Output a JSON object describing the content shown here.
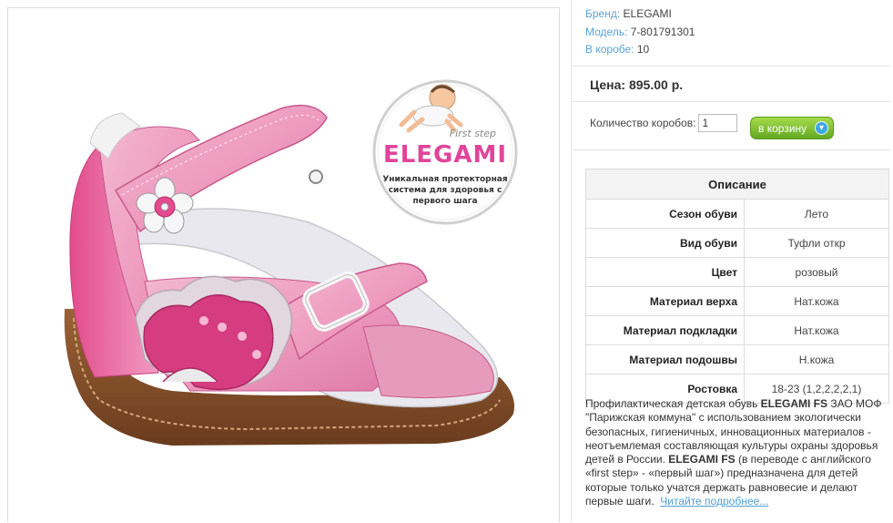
{
  "product": {
    "brand_label": "Бренд:",
    "brand": "ELEGAMI",
    "model_label": "Модель:",
    "model": "7-801791301",
    "box_label": "В коробе:",
    "box_count": "10",
    "price": "Цена: 895.00 р.",
    "quantity_label": "Количество коробов:",
    "quantity_value": "1",
    "add_to_cart": "в корзину"
  },
  "logo_badge": {
    "tagline": "First step",
    "brand": "ELEGAMI",
    "slogan_line1": "Уникальная протекторная",
    "slogan_line2": "система для здоровья с",
    "slogan_line3": "первого шага"
  },
  "specs": {
    "heading": "Описание",
    "rows": [
      {
        "name": "Сезон обуви",
        "value": "Лето"
      },
      {
        "name": "Вид обуви",
        "value": "Туфли откр"
      },
      {
        "name": "Цвет",
        "value": "розовый"
      },
      {
        "name": "Материал верха",
        "value": "Нат.кожа"
      },
      {
        "name": "Материал подкладки",
        "value": "Нат.кожа"
      },
      {
        "name": "Материал подошвы",
        "value": "Н.кожа"
      },
      {
        "name": "Ростовка",
        "value": "18-23 (1,2,2,2,2,1)"
      }
    ]
  },
  "description": {
    "p1": "Профилактическая детская обувь ",
    "b1": "ELEGAMI FS",
    "p2": " ЗАО МОФ \"Парижская коммуна\" с использованием экологически безопасных, гигиеничных, инновационных материалов - неотъемлемая составляющая культуры охраны здоровья детей в России. ",
    "b2": "ELEGAMI FS",
    "p3": " (в переводе с английского «first step» - «первый шаг») предназначена для детей которые только учатся держать равновесие и делают первые шаги.",
    "read_more": "Читайте подробнее..."
  },
  "colors": {
    "link": "#4fa0d4",
    "meta_label": "#5aa3d6",
    "button_green": "#7cc02e",
    "shoe_pink": "#e98fb6",
    "logo_pink": "#e0459a"
  }
}
